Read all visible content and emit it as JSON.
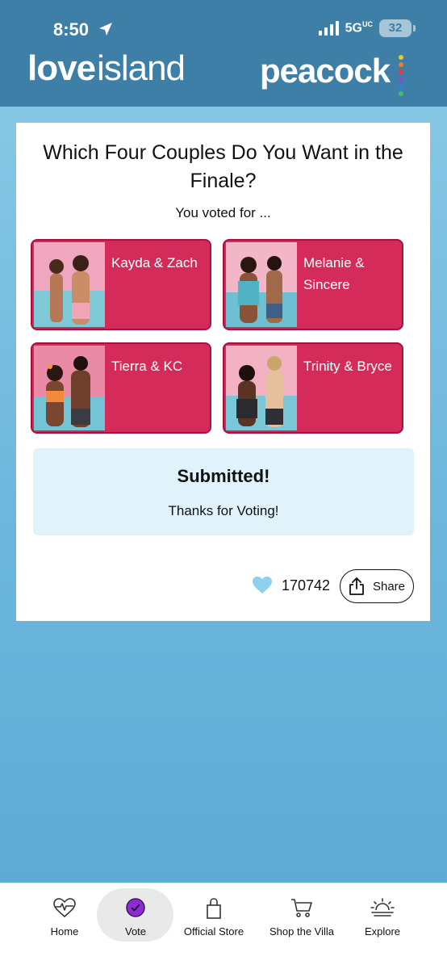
{
  "status_bar": {
    "time": "8:50",
    "network": "5G",
    "network_sub": "UC",
    "battery": "32"
  },
  "header": {
    "brand_left_bold": "love",
    "brand_left_rest": "island",
    "brand_right": "peacock"
  },
  "poll": {
    "title": "Which Four Couples Do You Want in the Finale?",
    "voted_label": "You voted for ...",
    "couples": [
      {
        "name": "Kayda & Zach"
      },
      {
        "name": "Melanie & Sincere"
      },
      {
        "name": "Tierra & KC"
      },
      {
        "name": "Trinity & Bryce"
      }
    ],
    "submitted_title": "Submitted!",
    "submitted_sub": "Thanks for Voting!",
    "like_count": "170742",
    "share_label": "Share"
  },
  "nav": {
    "items": [
      {
        "label": "Home",
        "icon": "heart-pulse-icon"
      },
      {
        "label": "Vote",
        "icon": "vote-check-icon",
        "active": true
      },
      {
        "label": "Official Store",
        "icon": "shopping-bag-icon"
      },
      {
        "label": "Shop the Villa",
        "icon": "cart-icon"
      },
      {
        "label": "Explore",
        "icon": "sunset-icon"
      }
    ]
  },
  "colors": {
    "header": "#3d7fa6",
    "couple_card": "#d52b5b",
    "accent_purple": "#8e2bd6",
    "heart": "#8fd0ef"
  }
}
